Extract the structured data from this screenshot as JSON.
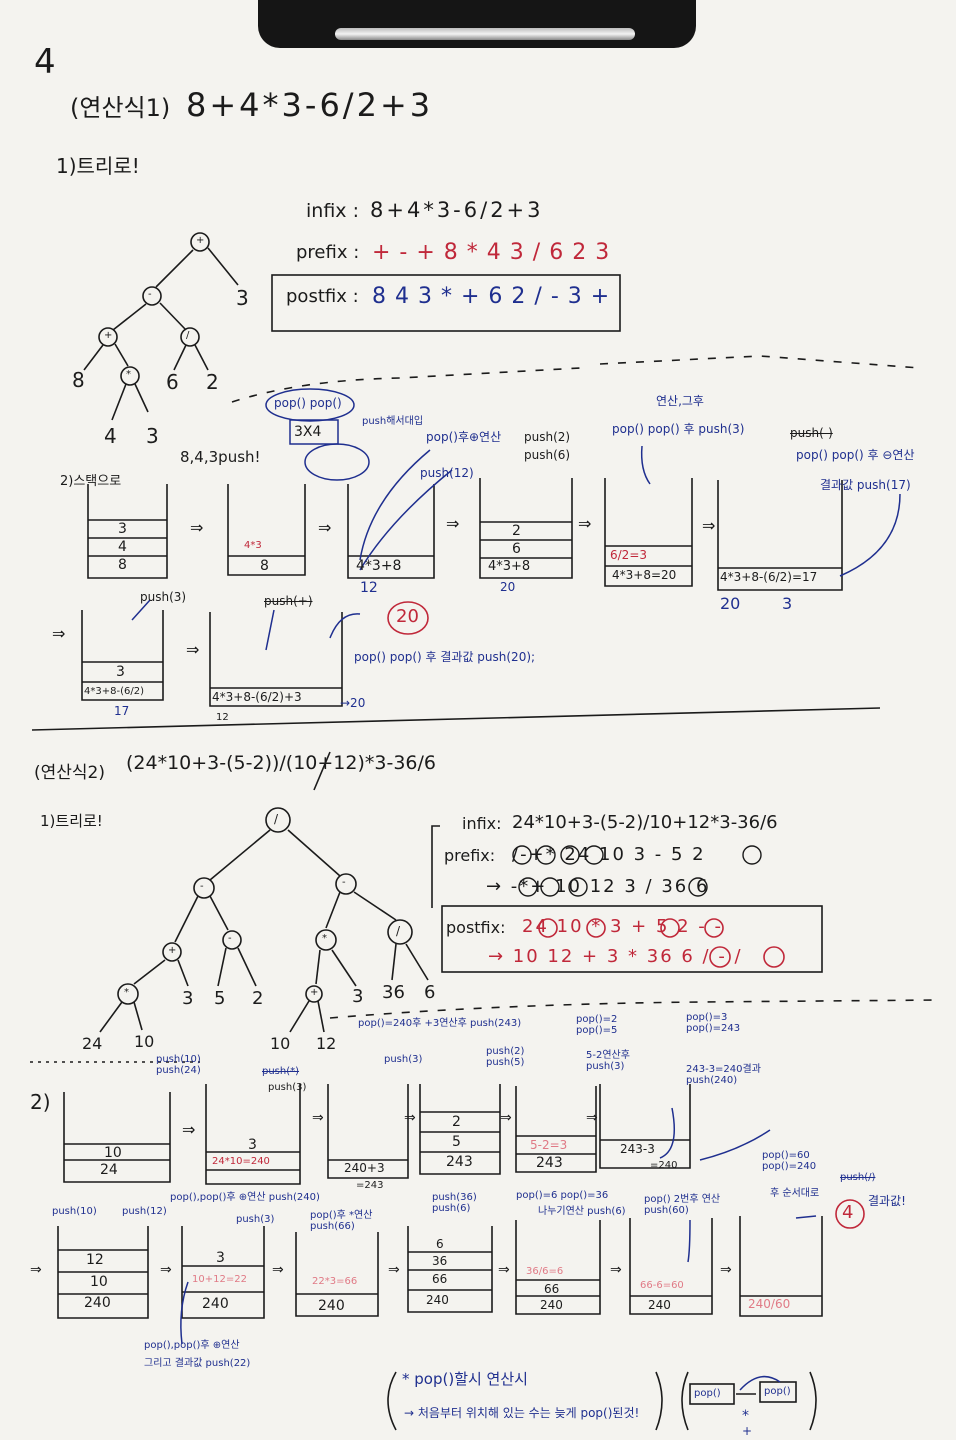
{
  "page": {
    "number": "4",
    "ex1_label": "(연산식1)",
    "ex1_expr": "8+4*3-6/2+3",
    "ex1_step1": "1)트리로!",
    "ex1_infix_label": "infix :",
    "ex1_infix": "8+4*3-6/2+3",
    "ex1_prefix_label": "prefix :",
    "ex1_prefix": "+-+8*43/623",
    "ex1_postfix_label": "postfix :",
    "ex1_postfix": "843*+62/-3+",
    "ex1_step2": "2)스택으로",
    "ex1_tree_nodes": [
      "+",
      "-",
      "3",
      "+",
      "/",
      "8",
      "*",
      "6",
      "2",
      "4",
      "3"
    ],
    "ex1_notes": {
      "push843": "8,4,3push!",
      "pop_pop": "pop() pop()",
      "three_x_four": "3X4",
      "push_result": "push해서대입",
      "pop_plus": "pop()후⊕연산",
      "push12": "push(12)",
      "push2": "push(2)",
      "push6": "push(6)",
      "calc": "연산,그후",
      "pop_pop_push3": "pop() pop() 후 push(3)",
      "push_minus": "push(-)",
      "pop_minus": "pop() pop() 후 ⊖연산",
      "result_push17": "결과값 push(17)",
      "push3": "push(3)",
      "push_plus": "push(+)",
      "pop_pop_push20": "pop() pop() 후 결과값 push(20);",
      "answer": "20"
    },
    "ex1_stacks": {
      "s1": [
        "3",
        "4",
        "8"
      ],
      "s2_top": "4*3",
      "s2_bot": "8",
      "s3": "4*3+8",
      "s3_below": "12",
      "s4": [
        "2",
        "6",
        "4*3+8"
      ],
      "s4_below": "20",
      "s5_top": "6/2=3",
      "s5_bot": "4*3+8=20",
      "s6": "4*3+8-(6/2)=17",
      "s6_below_a": "20",
      "s6_below_b": "3",
      "s7_top": "3",
      "s7_bot": "4*3+8-(6/2)",
      "s7_below": "17",
      "s8": "4*3+8-(6/2)+3",
      "s8_arrow": "→20",
      "s8_below": "12"
    },
    "ex2_label": "(연산식2)",
    "ex2_expr": "(24*10+3-(5-2))/(10+12)*3-36/6",
    "ex2_step1": "1)트리로!",
    "ex2_infix_label": "infix:",
    "ex2_infix": "24*10+3-(5-2)/10+12*3-36/6",
    "ex2_prefix_label": "prefix:",
    "ex2_prefix_line1": "/-+* 24 10 3 - 5 2",
    "ex2_prefix_line2": "→ -*+ 10 12 3 / 36 6",
    "ex2_postfix_label": "postfix:",
    "ex2_postfix_line1": "24 10 * 3 + 5 2 - -",
    "ex2_postfix_line2": "→ 10 12 + 3 * 36 6 / - /",
    "ex2_step2": "2)",
    "ex2_tree_nodes": [
      "/",
      "-",
      "-",
      "+",
      "-",
      "*",
      "/",
      "*",
      "3",
      "5",
      "2",
      "+",
      "3",
      "36",
      "6",
      "24",
      "10",
      "10",
      "12"
    ],
    "ex2_notes": {
      "push10_24": "push(10) push(24)",
      "push_star": "push(*)",
      "push3": "push(3)",
      "pop240": "pop()=240후 +3연산후 push(243)",
      "push3b": "push(3)",
      "push2_5": "push(2) push(5)",
      "pop2_5": "pop()=2 pop()=5",
      "five_minus_two": "5-2연산후 push(3)",
      "pop3_243": "pop()=3 pop()=243",
      "calc240": "243-3=240결과 push(240)",
      "push10b": "push(10)",
      "push12b": "push(12)",
      "pop_pop_plus": "pop(),pop()후 ⊕연산 push(240)",
      "push3c": "push(3)",
      "pop_mul": "pop()후 *연산 push(66)",
      "push36_6": "push(36) push(6)",
      "pop6_36": "pop()=6 pop()=36",
      "div_push6": "나누기연산 push(6)",
      "pop_sub": "pop() 2번후 연산 push(60)",
      "pop60_240": "pop()=60 pop()=240",
      "order": "후 순서대로",
      "push_slash": "push(/)",
      "result": "결과값!",
      "answer": "4",
      "bottom_note_a": "pop(),pop()후 ⊕연산",
      "bottom_note_b": "그리고 결과값 push(22)",
      "footer_1": "* pop()할시 연산시",
      "footer_2": "→ 처음부터 위치해 있는 수는 늦게 pop()된것!",
      "footer_pop": "pop()",
      "footer_pop2": "pop()",
      "footer_star": "*",
      "footer_plus": "+"
    },
    "ex2_stacks": {
      "a": [
        "10",
        "24"
      ],
      "b_top": "3",
      "b_bot": "24*10=240",
      "c": "240+3",
      "c_below": "=243",
      "d": [
        "2",
        "5",
        "243"
      ],
      "e_top": "5-2=3",
      "e_bot": "243",
      "f": "243-3",
      "f_below": "=240",
      "g": [
        "12",
        "10",
        "240"
      ],
      "h_top": "3",
      "h_mid": "10+12=22",
      "h_bot": "240",
      "i_top": "22*3=66",
      "i_bot": "240",
      "j": [
        "6",
        "36",
        "66",
        "240"
      ],
      "k_top": "36/6=6",
      "k_mid": "66",
      "k_bot": "240",
      "l_top": "66-6=60",
      "l_bot": "240",
      "m": "240/60"
    }
  }
}
